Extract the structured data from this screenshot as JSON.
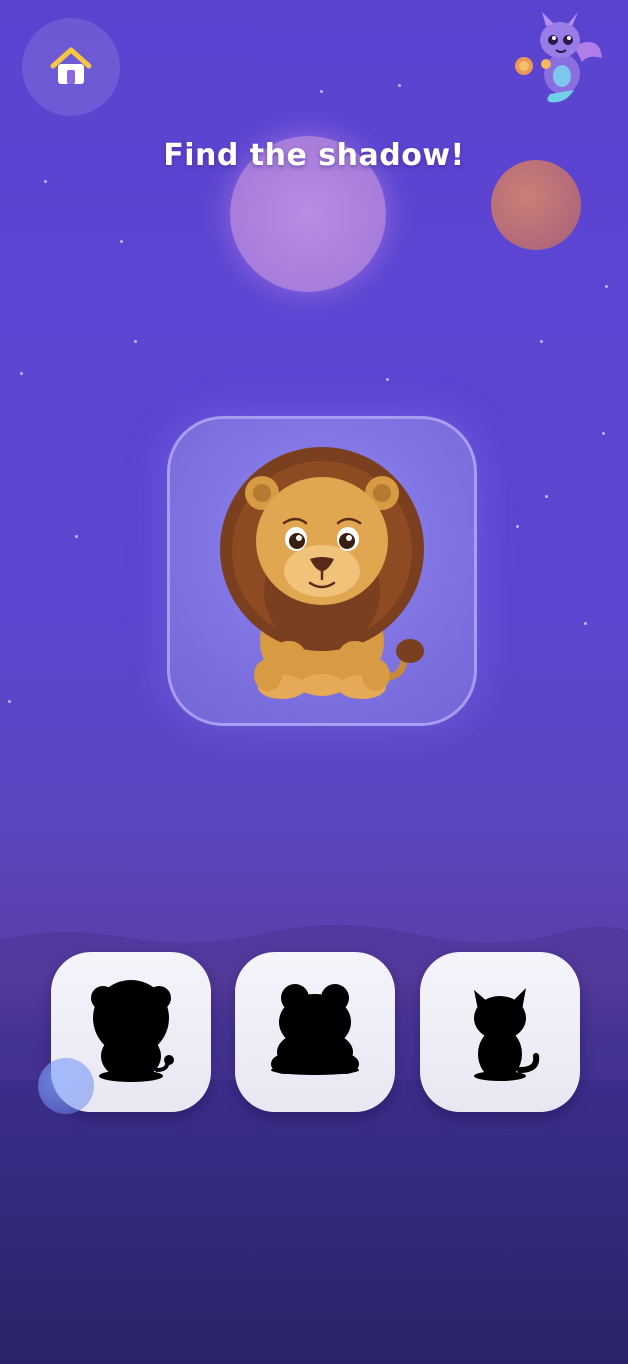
{
  "header": {
    "title": "Find the shadow!",
    "home_icon": "house-icon",
    "mascot_icon": "dragon-mascot-icon"
  },
  "target": {
    "animal": "lion",
    "icon": "lion-illustration"
  },
  "choices": [
    {
      "icon": "lion-silhouette-icon"
    },
    {
      "icon": "frog-silhouette-icon"
    },
    {
      "icon": "cat-silhouette-icon"
    }
  ],
  "colors": {
    "background_top": "#5a43cf",
    "background_bottom": "#2a2368",
    "card_border": "#c8beff",
    "choice_bg": "#f5f4fb",
    "silhouette": "#000000"
  }
}
